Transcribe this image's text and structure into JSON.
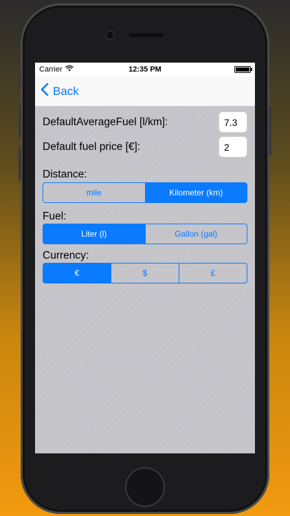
{
  "status_bar": {
    "carrier": "Carrier",
    "time": "12:35 PM"
  },
  "nav": {
    "back_label": "Back"
  },
  "settings": {
    "avg_fuel_label": "DefaultAverageFuel [l/km]:",
    "avg_fuel_value": "7.3",
    "fuel_price_label": "Default fuel price [€]:",
    "fuel_price_value": "2"
  },
  "distance": {
    "label": "Distance:",
    "options": [
      "mile",
      "Kilometer (km)"
    ],
    "selected": 1
  },
  "fuel": {
    "label": "Fuel:",
    "options": [
      "Liter (l)",
      "Gallon (gal)"
    ],
    "selected": 0
  },
  "currency": {
    "label": "Currency:",
    "options": [
      "€",
      "$",
      "£"
    ],
    "selected": 0
  },
  "colors": {
    "accent": "#0a7aff",
    "background_gradient_top": "#2b2b2b",
    "background_gradient_bottom": "#f29a10"
  }
}
